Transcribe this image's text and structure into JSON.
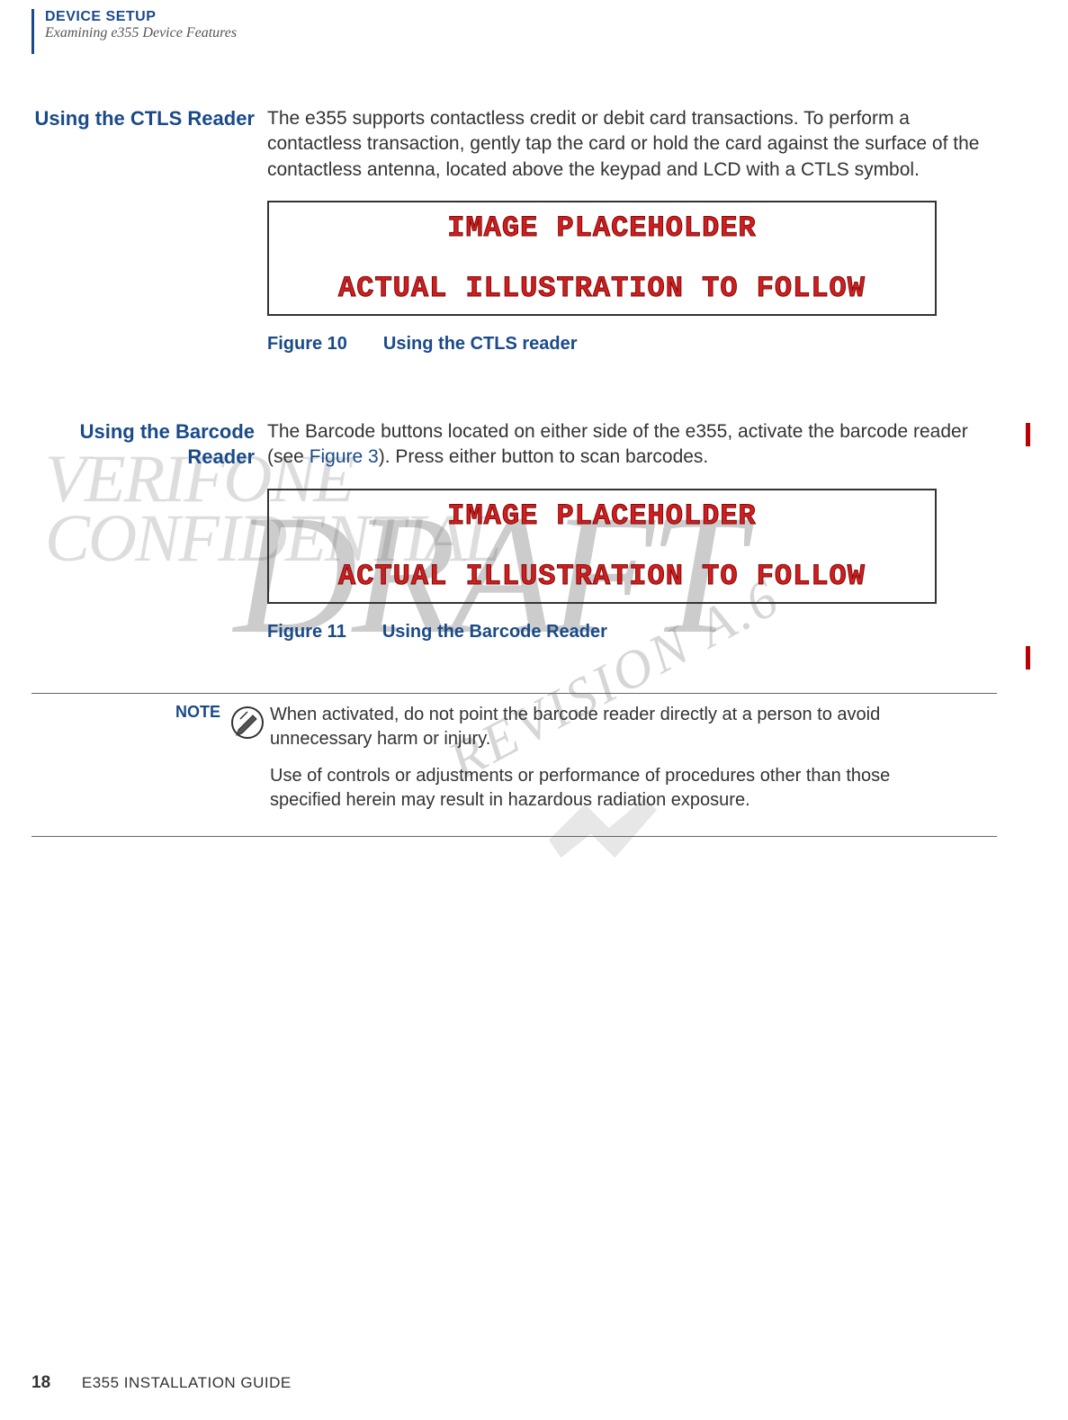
{
  "header": {
    "chapter": "DEVICE SETUP",
    "subtitle": "Examining e355 Device Features"
  },
  "section1": {
    "heading": "Using the CTLS Reader",
    "body": "The e355 supports contactless credit or debit card transactions. To perform a contactless transaction, gently tap the card or hold the card against the surface of the contactless antenna, located above the keypad and LCD with a CTLS symbol.",
    "placeholder_line1": "IMAGE PLACEHOLDER",
    "placeholder_line2": "ACTUAL ILLUSTRATION TO FOLLOW",
    "figure_label": "Figure 10",
    "figure_title": "Using the CTLS reader"
  },
  "section2": {
    "heading": "Using the Barcode Reader",
    "body_pre": "The Barcode buttons located on either side of the e355, activate the barcode reader (see ",
    "figure_ref": "Figure 3",
    "body_post": "). Press either button to scan barcodes.",
    "placeholder_line1": "IMAGE PLACEHOLDER",
    "placeholder_line2": "ACTUAL ILLUSTRATION TO FOLLOW",
    "figure_label": "Figure 11",
    "figure_title": "Using the Barcode Reader"
  },
  "note": {
    "label": "NOTE",
    "para1": "When activated, do not point the barcode reader directly at a person to avoid unnecessary harm or injury.",
    "para2": "Use of controls or adjustments or performance of procedures other than those specified herein may result in hazardous radiation exposure."
  },
  "watermarks": {
    "confidential_line1": "VERIFONE",
    "confidential_line2": "CONFIDENTIAL",
    "draft": "DRAFT",
    "revision": "REVISION A.6"
  },
  "footer": {
    "page_number": "18",
    "book_title": "E355 INSTALLATION GUIDE"
  }
}
